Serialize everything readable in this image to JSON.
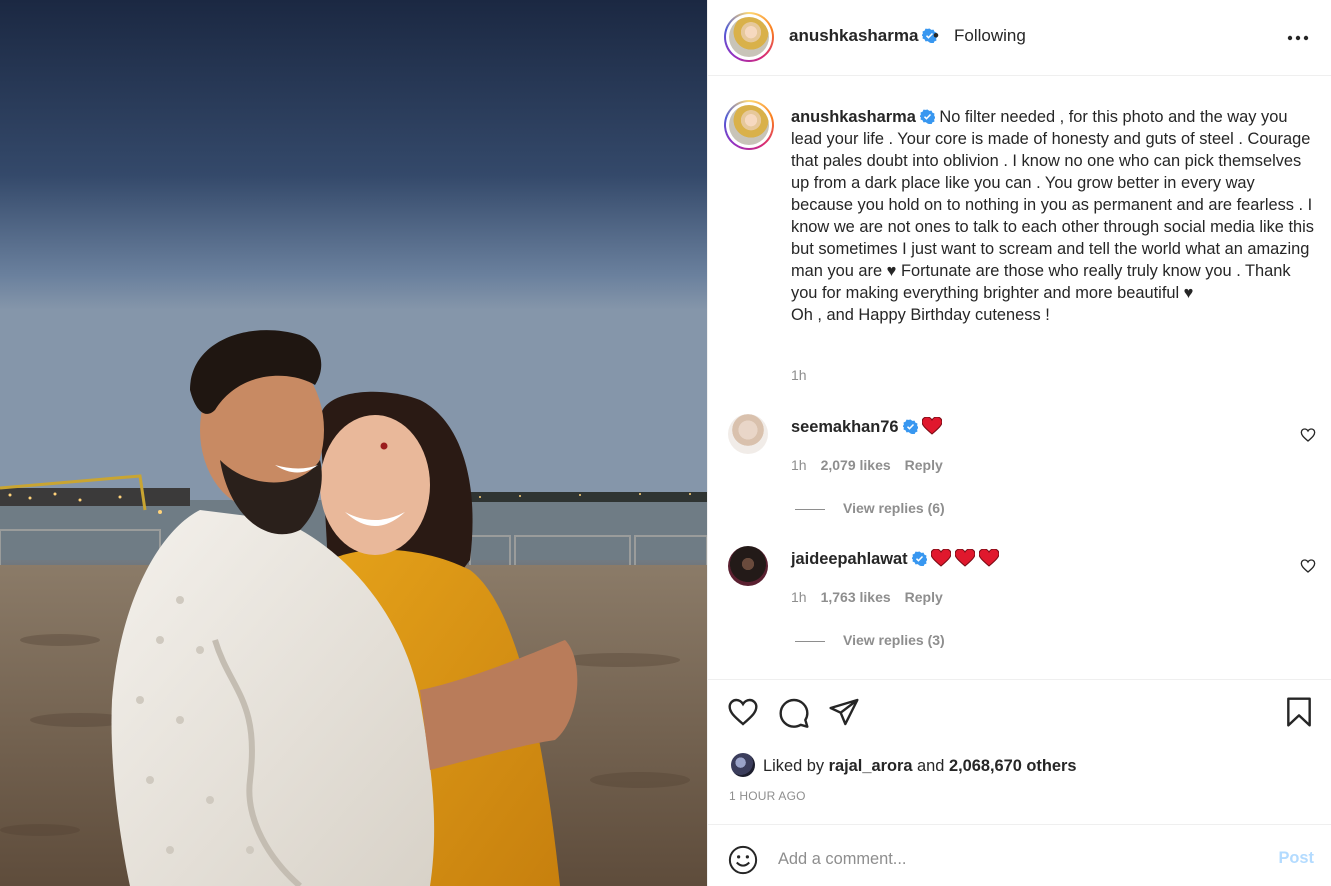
{
  "post": {
    "username": "anushkasharma",
    "separator": "•",
    "follow_status": "Following"
  },
  "caption": {
    "username": "anushkasharma",
    "text": "No filter needed , for this photo and the way you lead your life . Your core is made of honesty and guts of steel . Courage that pales doubt into oblivion . I know no one who can pick themselves up from a dark place like you can . You grow better in every way because you hold on to nothing in you as permanent and are fearless . I know we are not ones to talk to each other through social media like this but sometimes I just want to scream and tell the world what an amazing man you are ♥ Fortunate are those who really truly know you . Thank you for making everything brighter and more beautiful ♥\nOh , and Happy Birthday cuteness !",
    "time": "1h"
  },
  "comments": [
    {
      "username": "seemakhan76",
      "emoji": [
        "heart"
      ],
      "time": "1h",
      "likes": "2,079 likes",
      "reply": "Reply",
      "view_replies": "View replies (6)"
    },
    {
      "username": "jaideepahlawat",
      "emoji": [
        "heart",
        "heart",
        "heart"
      ],
      "time": "1h",
      "likes": "1,763 likes",
      "reply": "Reply",
      "view_replies": "View replies (3)"
    }
  ],
  "actions": {
    "icons": [
      "heart-icon",
      "comment-icon",
      "share-icon",
      "bookmark-icon"
    ]
  },
  "likes": {
    "prefix": "Liked by",
    "user": "rajal_arora",
    "and": "and",
    "others": "2,068,670 others"
  },
  "timestamp": "1 HOUR AGO",
  "add_comment": {
    "placeholder": "Add a comment...",
    "post_label": "Post"
  },
  "colors": {
    "verified": "#3897f0",
    "emoji_heart": "#e0182d",
    "muted": "#8e8e8e",
    "post_disabled": "#b3dbff"
  }
}
